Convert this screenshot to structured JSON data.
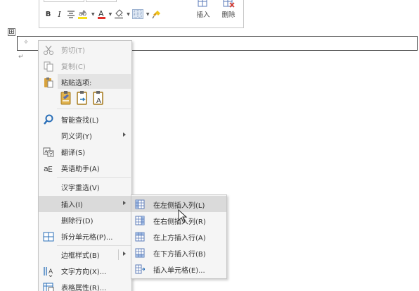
{
  "toolbar": {
    "bold": "B",
    "italic": "I",
    "insert_label": "插入",
    "delete_label": "删除",
    "colors": {
      "highlight": "#f7e017",
      "font_color": "#e0312b"
    }
  },
  "document": {
    "table_handle": "⊞",
    "paragraph_mark": "↵"
  },
  "context_menu": {
    "cut": "剪切(T)",
    "copy": "复制(C)",
    "paste_options": "粘贴选项:",
    "smart_lookup": "智能查找(L)",
    "synonyms": "同义词(Y)",
    "translate": "翻译(S)",
    "english_assistant": "英语助手(A)",
    "reconvert": "汉字重选(V)",
    "insert": "插入(I)",
    "delete_row": "删除行(D)",
    "split_cells": "拆分单元格(P)...",
    "border_styles": "边框样式(B)",
    "text_direction": "文字方向(X)...",
    "table_properties": "表格属性(R)..."
  },
  "insert_submenu": {
    "insert_left": "在左侧插入列(L)",
    "insert_right": "在右侧插入列(R)",
    "insert_above": "在上方插入行(A)",
    "insert_below": "在下方插入行(B)",
    "insert_cells": "插入单元格(E)..."
  }
}
